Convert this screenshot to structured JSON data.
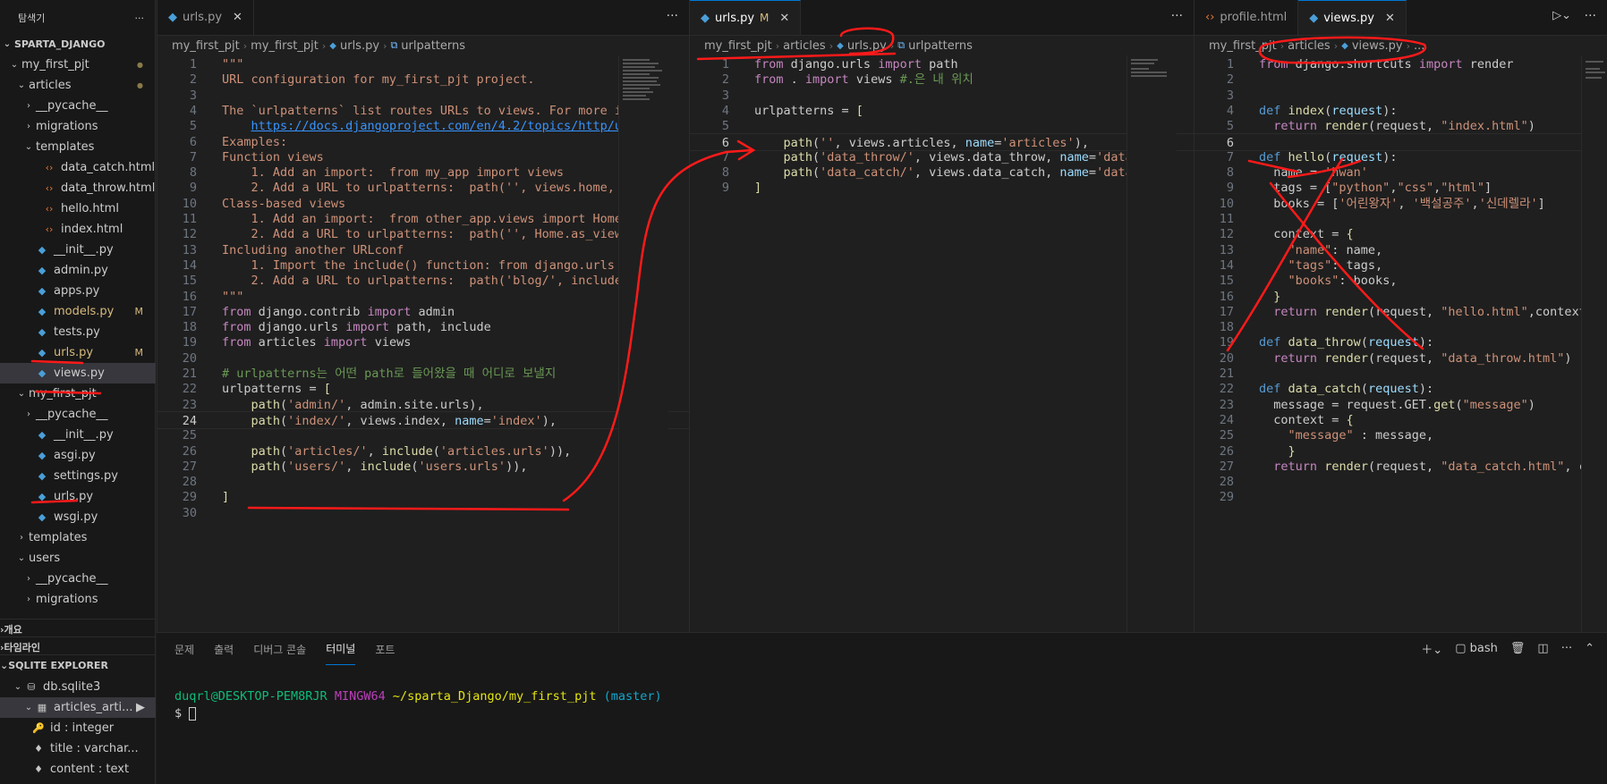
{
  "sidebar": {
    "title": "탐색기",
    "more_icon": "ellipsis-icon",
    "project": "SPARTA_DJANGO",
    "tree": [
      {
        "label": "my_first_pjt",
        "kind": "folder-open",
        "depth": 1,
        "mod": "dot"
      },
      {
        "label": "articles",
        "kind": "folder-open",
        "depth": 2,
        "mod": "dot"
      },
      {
        "label": "__pycache__",
        "kind": "folder",
        "depth": 3
      },
      {
        "label": "migrations",
        "kind": "folder",
        "depth": 3
      },
      {
        "label": "templates",
        "kind": "folder-open",
        "depth": 3
      },
      {
        "label": "data_catch.html",
        "kind": "html",
        "depth": 4
      },
      {
        "label": "data_throw.html",
        "kind": "html",
        "depth": 4
      },
      {
        "label": "hello.html",
        "kind": "html",
        "depth": 4
      },
      {
        "label": "index.html",
        "kind": "html",
        "depth": 4
      },
      {
        "label": "__init__.py",
        "kind": "py",
        "depth": 3
      },
      {
        "label": "admin.py",
        "kind": "py",
        "depth": 3
      },
      {
        "label": "apps.py",
        "kind": "py",
        "depth": 3
      },
      {
        "label": "models.py",
        "kind": "py-mod",
        "depth": 3,
        "mod": "M"
      },
      {
        "label": "tests.py",
        "kind": "py",
        "depth": 3
      },
      {
        "label": "urls.py",
        "kind": "py-mod",
        "depth": 3,
        "mod": "M"
      },
      {
        "label": "views.py",
        "kind": "py",
        "depth": 3,
        "selected": true
      },
      {
        "label": "my_first_pjt",
        "kind": "folder-open",
        "depth": 2
      },
      {
        "label": "__pycache__",
        "kind": "folder",
        "depth": 3
      },
      {
        "label": "__init__.py",
        "kind": "py",
        "depth": 3
      },
      {
        "label": "asgi.py",
        "kind": "py",
        "depth": 3
      },
      {
        "label": "settings.py",
        "kind": "py",
        "depth": 3
      },
      {
        "label": "urls.py",
        "kind": "py",
        "depth": 3
      },
      {
        "label": "wsgi.py",
        "kind": "py",
        "depth": 3
      },
      {
        "label": "templates",
        "kind": "folder",
        "depth": 2
      },
      {
        "label": "users",
        "kind": "folder-open",
        "depth": 2
      },
      {
        "label": "__pycache__",
        "kind": "folder",
        "depth": 3
      },
      {
        "label": "migrations",
        "kind": "folder",
        "depth": 3
      }
    ],
    "sections": [
      {
        "label": "개요"
      },
      {
        "label": "타임라인"
      },
      {
        "label": "SQLITE EXPLORER"
      }
    ],
    "sqlite": [
      {
        "label": "db.sqlite3",
        "icon": "database-icon",
        "depth": 1
      },
      {
        "label": "articles_arti...",
        "icon": "table-icon",
        "depth": 2
      },
      {
        "label": "id : integer",
        "icon": "key-icon",
        "depth": 3
      },
      {
        "label": "title : varchar...",
        "icon": "diamond-icon",
        "depth": 3
      },
      {
        "label": "content : text",
        "icon": "diamond-icon",
        "depth": 3
      }
    ]
  },
  "editor1": {
    "tab": {
      "label": "urls.py"
    },
    "crumbs": [
      "my_first_pjt",
      "my_first_pjt",
      "urls.py",
      "urlpatterns"
    ],
    "current_line": 24
  },
  "editor2": {
    "tab": {
      "label": "urls.py",
      "mod": "M"
    },
    "crumbs": [
      "my_first_pjt",
      "articles",
      "urls.py",
      "urlpatterns"
    ],
    "current_line": 6
  },
  "editor3": {
    "tabs": [
      {
        "label": "profile.html"
      },
      {
        "label": "views.py"
      }
    ],
    "crumbs": [
      "my_first_pjt",
      "articles",
      "views.py",
      "..."
    ],
    "current_line": 6
  },
  "panel": {
    "tabs": [
      "문제",
      "출력",
      "디버그 콘솔",
      "터미널",
      "포트"
    ],
    "active_tab": "터미널",
    "shell_label": "bash",
    "terminal": {
      "user": "duqrl@DESKTOP-PEM8RJR",
      "env": "MINGW64",
      "path": "~/sparta_Django/my_first_pjt",
      "branch": "(master)",
      "prompt": "$"
    }
  },
  "colors": {
    "accent": "#0078d4",
    "annotation": "#ff1a1a"
  }
}
